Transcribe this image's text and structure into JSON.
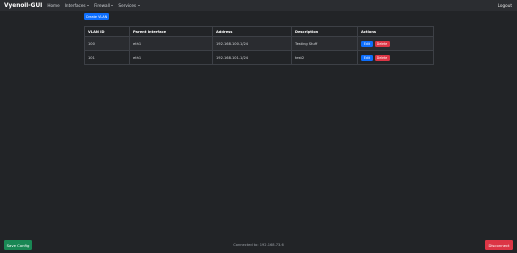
{
  "navbar": {
    "brand": "Vyenoil-GUI",
    "items": [
      {
        "label": "Home"
      },
      {
        "label": "Interfaces"
      },
      {
        "label": "Firewall"
      },
      {
        "label": "Services"
      }
    ],
    "logout": "Logout"
  },
  "actions": {
    "create_label": "Create VLAN"
  },
  "table": {
    "headers": [
      "VLAN ID",
      "Parent Interface",
      "Address",
      "Description",
      "Actions"
    ],
    "rows": [
      {
        "vlan_id": "100",
        "parent": "eth1",
        "address": "192.168.100.1/24",
        "description": "Testing Stuff"
      },
      {
        "vlan_id": "101",
        "parent": "eth1",
        "address": "192.168.101.1/24",
        "description": "test2"
      }
    ],
    "edit_label": "Edit",
    "delete_label": "Delete"
  },
  "footer": {
    "save_label": "Save Config",
    "status": "Connected to: 192.168.73.6",
    "disconnect_label": "Disconnect"
  },
  "colors": {
    "background": "#222427",
    "navbar": "#2b2d31",
    "primary": "#0d6efd",
    "danger": "#dc3545",
    "success": "#198754"
  }
}
